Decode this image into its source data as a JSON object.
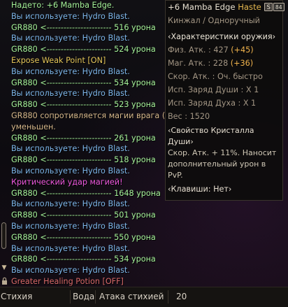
{
  "chat": [
    {
      "text": "Надето: +6 Mamba Edge.",
      "cls": "c-sys"
    },
    {
      "text": "Вы используете: Hydro Blast.",
      "cls": "c-blue"
    },
    {
      "text": "GR880 <-----------------------  516 урона",
      "cls": "c-green"
    },
    {
      "text": "Вы используете: Hydro Blast.",
      "cls": "c-blue"
    },
    {
      "text": "GR880 <-----------------------  524 урона",
      "cls": "c-green"
    },
    {
      "text": "Expose Weak Point [ON]",
      "cls": "c-yellow"
    },
    {
      "text": "Вы используете: Hydro Blast.",
      "cls": "c-blue"
    },
    {
      "text": "GR880 <-----------------------  534 урона",
      "cls": "c-green"
    },
    {
      "text": "Вы используете: Hydro Blast.",
      "cls": "c-blue"
    },
    {
      "text": "GR880 <-----------------------  523 урона",
      "cls": "c-green"
    },
    {
      "text": "GR880 сопротивляется магии врага (",
      "cls": "c-tan"
    },
    {
      "text": " уменьшен.",
      "cls": "c-tan"
    },
    {
      "text": "GR880 <-----------------------  261 урона",
      "cls": "c-green"
    },
    {
      "text": "Вы используете: Hydro Blast.",
      "cls": "c-blue"
    },
    {
      "text": "GR880 <-----------------------  518 урона",
      "cls": "c-green"
    },
    {
      "text": "Вы используете: Hydro Blast.",
      "cls": "c-blue"
    },
    {
      "text": "Критический удар магией!",
      "cls": "c-crit"
    },
    {
      "text": "GR880 <-----------------------  1648 урона",
      "cls": "c-green"
    },
    {
      "text": "Вы используете: Hydro Blast.",
      "cls": "c-blue"
    },
    {
      "text": "GR880 <-----------------------  501 урона",
      "cls": "c-green"
    },
    {
      "text": "Вы используете: Hydro Blast.",
      "cls": "c-blue"
    },
    {
      "text": "GR880 <-----------------------  550 урона",
      "cls": "c-green"
    },
    {
      "text": "Вы используете: Hydro Blast.",
      "cls": "c-blue"
    },
    {
      "text": "GR880 <-----------------------  534 урона",
      "cls": "c-green"
    },
    {
      "text": "Вы используете: Hydro Blast.",
      "cls": "c-blue"
    },
    {
      "text": "Greater Healing Potion [OFF]",
      "cls": "c-red"
    }
  ],
  "tooltip": {
    "title_prefix": "+6 Mamba Edge",
    "title_haste": "Haste",
    "badge_s": "S",
    "badge_num": "84",
    "subtitle": "Кинжал / Одноручный",
    "characteristics_header": "‹Характеристики оружия›",
    "phys_atk_label": "Физ. Атк. : 427",
    "phys_atk_bonus": "(+45)",
    "mag_atk_label": "Маг. Атк. : 228",
    "mag_atk_bonus": "(+36)",
    "atk_speed": "Скор. Атк. : Оч. быстро",
    "soulshot": "Исп. Заряд Души : X 1",
    "spiritshot": "Исп. Заряд Духа : X 1",
    "weight": "Вес : 1520",
    "crystal_header": "‹Свойство Кристалла Души›",
    "crystal_desc": "Скор. Атк. + 11%. Наносит дополнительный урон в PvP.",
    "keys": "‹Клавиши: Нет›"
  },
  "bottom_bar": {
    "element_label": "Стихия",
    "element_value": "Вода",
    "attack_label": "Атака стихией",
    "attack_value": "20"
  },
  "colors": {
    "damage_green": "#a6f29a",
    "skill_blue": "#7fb8ec",
    "crit_magenta": "#f05ae0",
    "bonus_orange": "#f0b34c"
  }
}
